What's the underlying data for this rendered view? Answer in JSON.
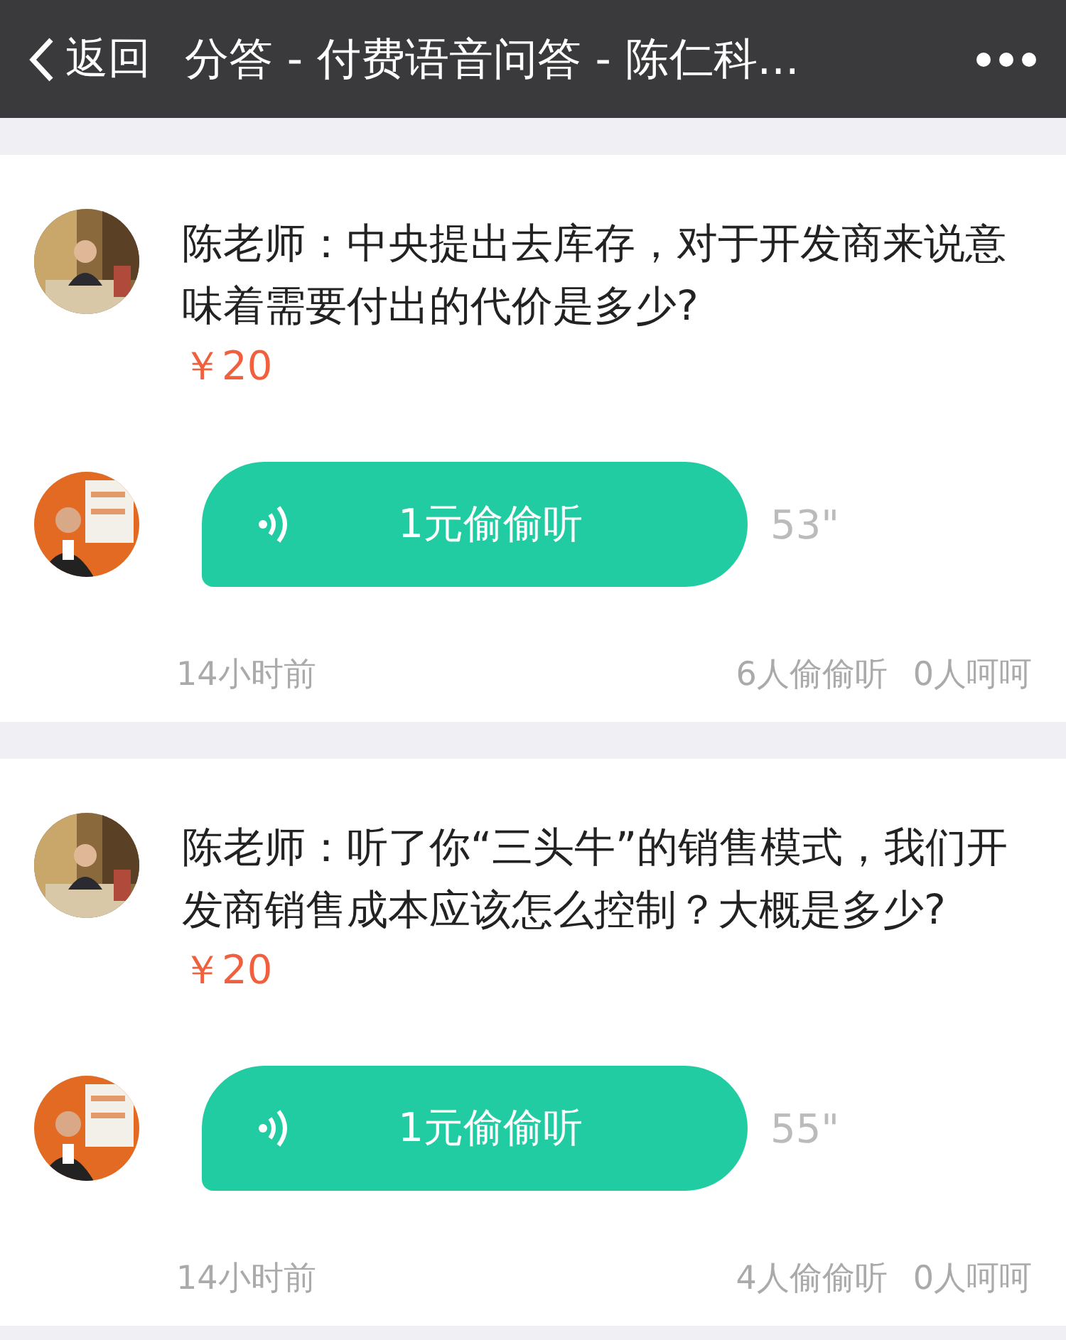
{
  "header": {
    "back_label": "返回",
    "title": "分答 - 付费语音问答 - 陈仁科..."
  },
  "questions": [
    {
      "question": "陈老师：中央提出去库存，对于开发商来说意味着需要付出的代价是多少?",
      "price": "￥20",
      "answer_label": "1元偷偷听",
      "duration": "53\"",
      "time": "14小时前",
      "listens": "6人偷偷听",
      "likes": "0人呵呵"
    },
    {
      "question": "陈老师：听了你“三头牛”的销售模式，我们开发商销售成本应该怎么控制？大概是多少?",
      "price": "￥20",
      "answer_label": "1元偷偷听",
      "duration": "55\"",
      "time": "14小时前",
      "listens": "4人偷偷听",
      "likes": "0人呵呵"
    }
  ]
}
